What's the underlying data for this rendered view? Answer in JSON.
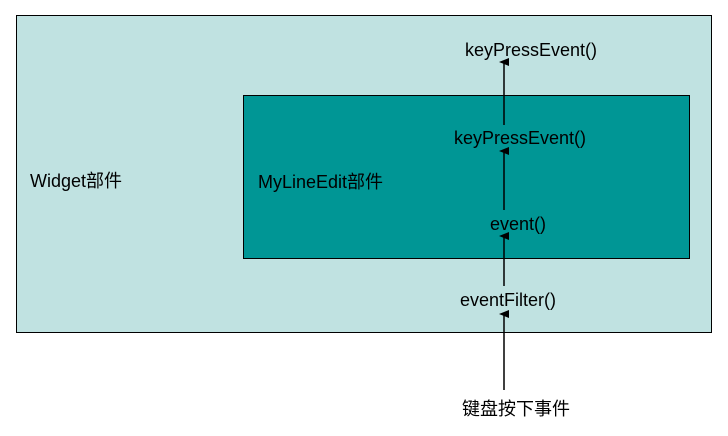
{
  "colors": {
    "outer_fill": "#c0e2e1",
    "inner_fill": "#009695",
    "line": "#000000",
    "text": "#000000"
  },
  "outer": {
    "label": "Widget部件",
    "top_label": "keyPressEvent()",
    "filter_label": "eventFilter()"
  },
  "inner": {
    "label": "MyLineEdit部件",
    "top_label": "keyPressEvent()",
    "event_label": "event()"
  },
  "source": {
    "label": "键盘按下事件"
  }
}
